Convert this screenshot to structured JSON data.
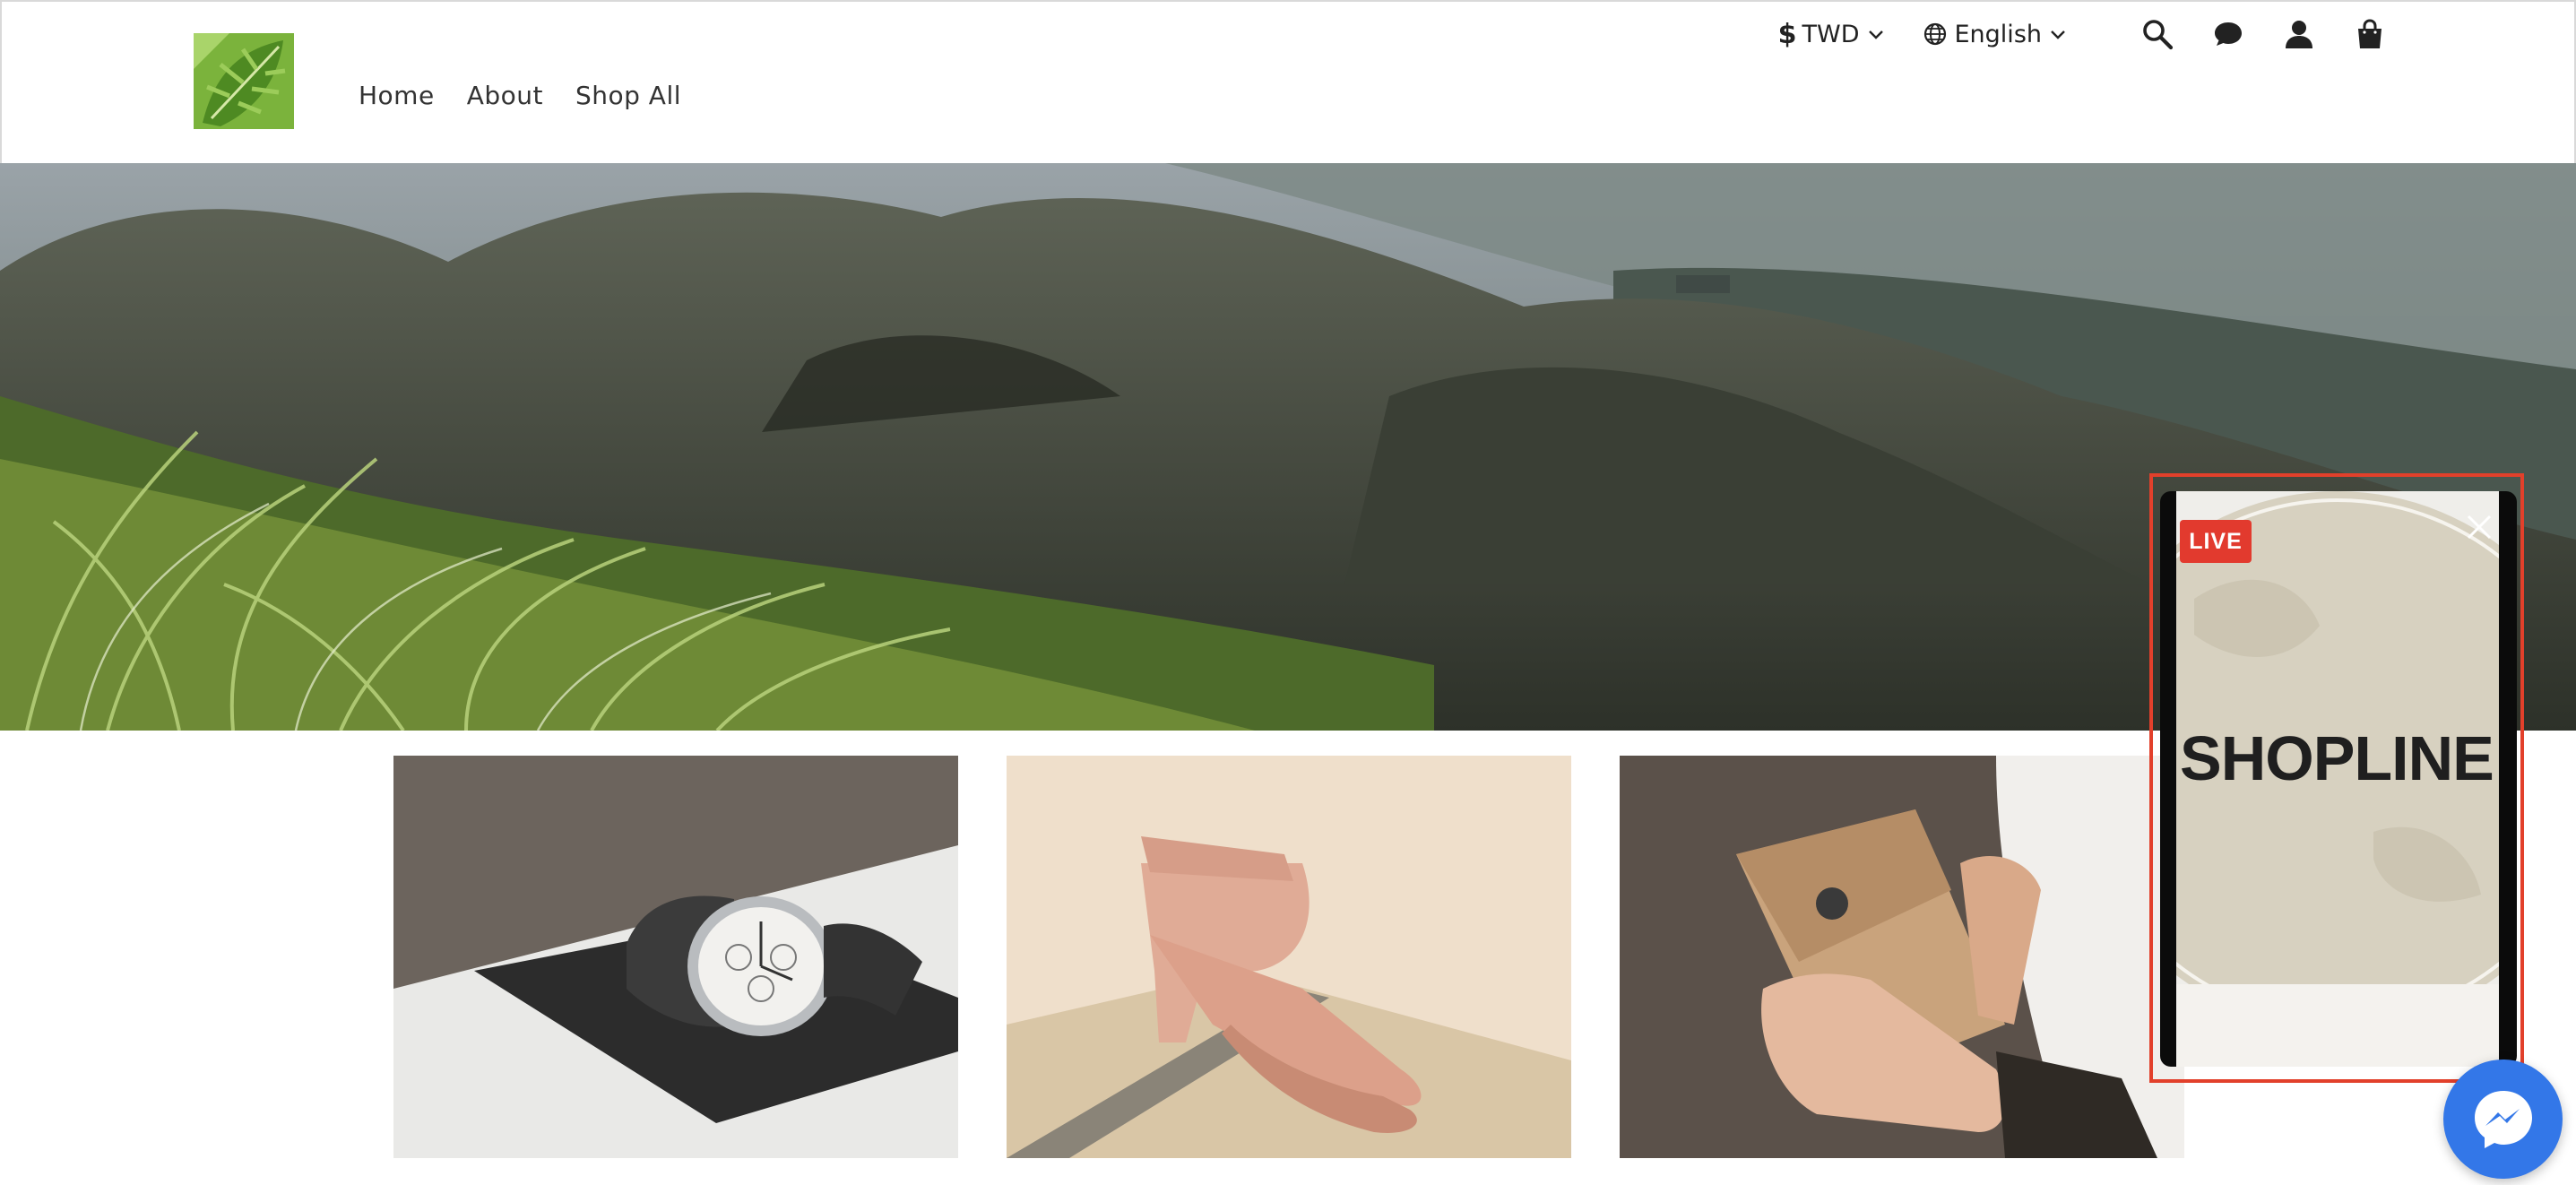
{
  "header": {
    "nav": [
      {
        "label": "Home"
      },
      {
        "label": "About"
      },
      {
        "label": "Shop All"
      }
    ],
    "currency": {
      "symbol": "$",
      "label": "TWD"
    },
    "language": {
      "label": "English"
    },
    "icons": [
      "search-icon",
      "chat-icon",
      "user-icon",
      "cart-icon"
    ]
  },
  "live_widget": {
    "badge": "LIVE",
    "brand": "SHOPLINE",
    "accent": "#e23a2e"
  },
  "colors": {
    "messenger": "#3377e8",
    "frame_highlight": "#e2402b"
  }
}
